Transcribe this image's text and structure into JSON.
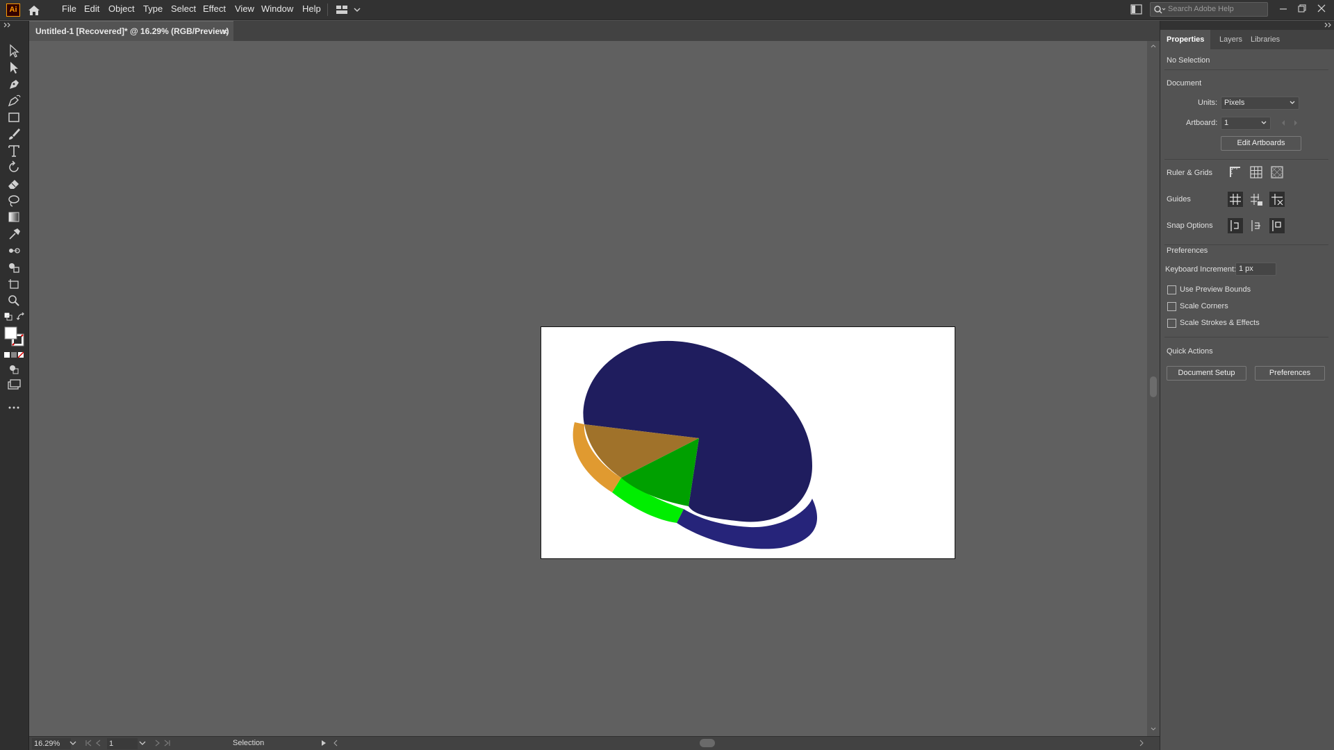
{
  "app": {
    "logo_text": "Ai",
    "menus": [
      "File",
      "Edit",
      "Object",
      "Type",
      "Select",
      "Effect",
      "View",
      "Window",
      "Help"
    ],
    "search_placeholder": "Search Adobe Help"
  },
  "document": {
    "tab_title": "Untitled-1 [Recovered]* @ 16.29% (RGB/Preview)",
    "tab_close": "×"
  },
  "tools": [
    "selection-tool",
    "direct-selection-tool",
    "pen-tool",
    "curvature-tool",
    "rectangle-tool",
    "paintbrush-tool",
    "type-tool",
    "rotate-tool",
    "eraser-tool",
    "lasso-tool",
    "gradient-tool",
    "eyedropper-tool",
    "blend-tool",
    "shape-builder-tool",
    "artboard-tool",
    "zoom-tool"
  ],
  "artwork": {
    "type": "3d-pie",
    "slices": [
      {
        "color": "#1f1d5e",
        "side_color": "#26247a"
      },
      {
        "color": "#a0722a",
        "side_color": "#e09a30"
      },
      {
        "color": "#00a000",
        "side_color": "#00ee00"
      }
    ]
  },
  "status": {
    "zoom": "16.29%",
    "artboard": "1",
    "tool_name": "Selection"
  },
  "properties": {
    "tabs": [
      "Properties",
      "Layers",
      "Libraries"
    ],
    "selection": "No Selection",
    "document_heading": "Document",
    "units_label": "Units:",
    "units_value": "Pixels",
    "artboard_label": "Artboard:",
    "artboard_value": "1",
    "edit_artboards": "Edit Artboards",
    "ruler_grids": "Ruler & Grids",
    "guides": "Guides",
    "snap_options": "Snap Options",
    "preferences_heading": "Preferences",
    "keyboard_increment_label": "Keyboard Increment:",
    "keyboard_increment_value": "1 px",
    "checkboxes": [
      "Use Preview Bounds",
      "Scale Corners",
      "Scale Strokes & Effects"
    ],
    "quick_actions": "Quick Actions",
    "document_setup": "Document Setup",
    "preferences_button": "Preferences"
  }
}
